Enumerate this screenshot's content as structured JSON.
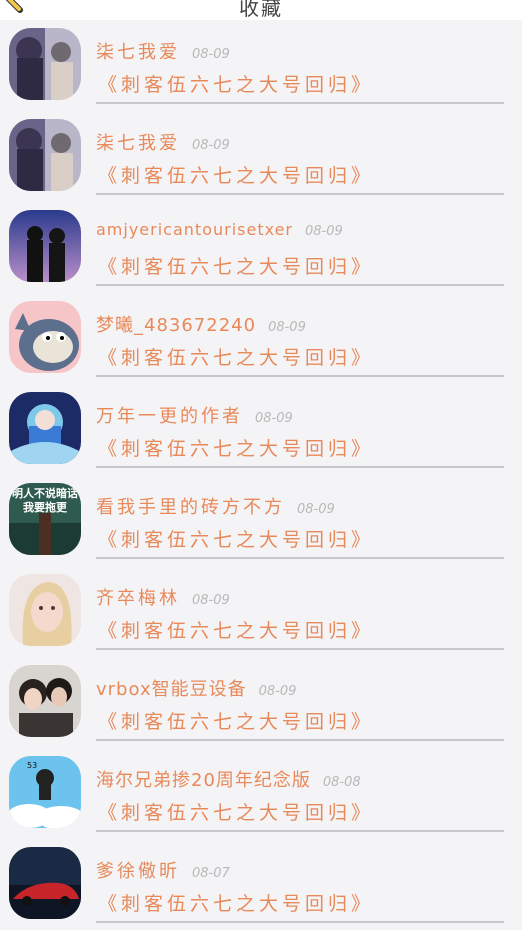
{
  "header": {
    "title": "收藏",
    "icon": "pencil-icon"
  },
  "favorites": [
    {
      "name": "柒七我爱",
      "date": "08-09",
      "subtitle": "《刺客伍六七之大号回归》",
      "avatar": "anime-boys"
    },
    {
      "name": "柒七我爱",
      "date": "08-09",
      "subtitle": "《刺客伍六七之大号回归》",
      "avatar": "anime-boys"
    },
    {
      "name": "amjyericantourisetxer",
      "date": "08-09",
      "subtitle": "《刺客伍六七之大号回归》",
      "avatar": "night-couple"
    },
    {
      "name": "梦曦_483672240",
      "date": "08-09",
      "subtitle": "《刺客伍六七之大号回归》",
      "avatar": "cartoon-cat"
    },
    {
      "name": "万年一更的作者",
      "date": "08-09",
      "subtitle": "《刺客伍六七之大号回归》",
      "avatar": "blue-anime-girl"
    },
    {
      "name": "看我手里的砖方不方",
      "date": "08-09",
      "subtitle": "《刺客伍六七之大号回归》",
      "avatar": "text-meme",
      "avatar_text": [
        "明人不说暗话",
        "我要拖更"
      ]
    },
    {
      "name": "齐卒梅林",
      "date": "08-09",
      "subtitle": "《刺客伍六七之大号回归》",
      "avatar": "blonde-girl"
    },
    {
      "name": "vrbox智能豆设备",
      "date": "08-09",
      "subtitle": "《刺客伍六七之大号回归》",
      "avatar": "couple-photo"
    },
    {
      "name": "海尔兄弟掺20周年纪念版",
      "date": "08-08",
      "subtitle": "《刺客伍六七之大号回归》",
      "avatar": "sky-cartoon",
      "avatar_text": [
        "53"
      ]
    },
    {
      "name": "爹徐儆昕",
      "date": "08-07",
      "subtitle": "《刺客伍六七之大号回归》",
      "avatar": "red-car"
    }
  ],
  "colors": {
    "accent": "#e8895a",
    "date": "#b8b8b8",
    "divider": "#c8c8c8",
    "background": "#f4f4f6"
  }
}
